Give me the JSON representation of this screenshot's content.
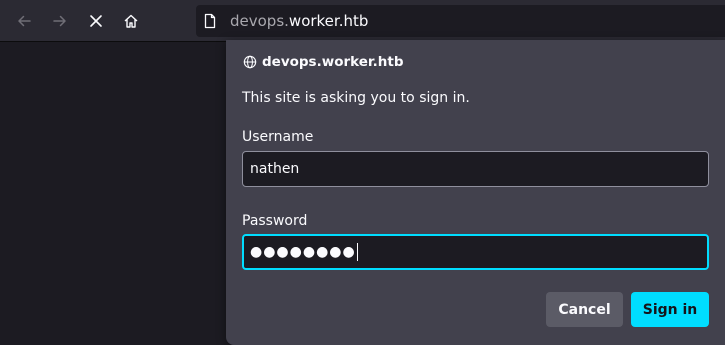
{
  "toolbar": {
    "back_icon": "arrow-left-icon",
    "forward_icon": "arrow-right-icon",
    "stop_icon": "close-icon",
    "home_icon": "home-icon",
    "url_prefix": "devops.",
    "url_domain": "worker.htb"
  },
  "dialog": {
    "host": "devops.worker.htb",
    "message": "This site is asking you to sign in.",
    "username_label": "Username",
    "username_value": "nathen",
    "password_label": "Password",
    "password_dots": "●●●●●●●●",
    "cancel_label": "Cancel",
    "signin_label": "Sign in"
  },
  "colors": {
    "accent": "#00ddff",
    "dialog_bg": "#42414d",
    "toolbar_bg": "#2b2a33",
    "page_bg": "#1c1b22"
  }
}
